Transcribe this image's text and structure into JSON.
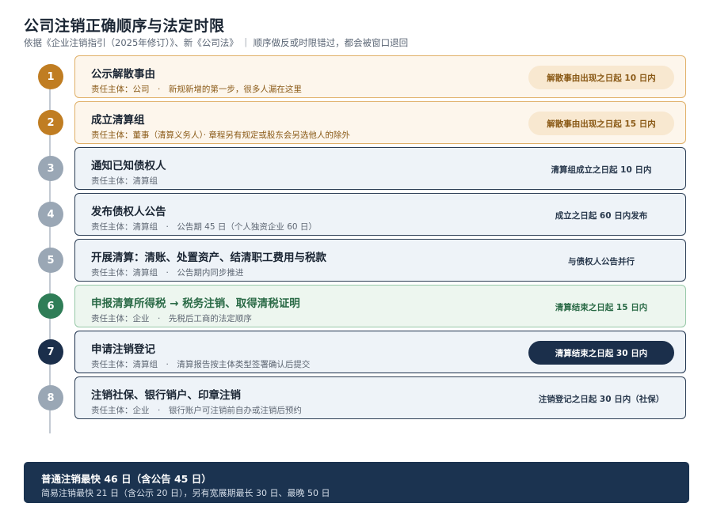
{
  "header": {
    "title": "公司注销正确顺序与法定时限",
    "subtitle": "依据《企业注销指引（2025年修订）》、新《公司法》 ｜ 顺序做反或时限错过，都会被窗口退回"
  },
  "steps": [
    {
      "number": "1",
      "title": "公示解散事由",
      "desc": "责任主体：公司　·　新规新增的第一步，很多人漏在这里",
      "deadline": "解散事由出现之日起 10 日内",
      "style": "warn"
    },
    {
      "number": "2",
      "title": "成立清算组",
      "desc": "责任主体：董事（清算义务人）· 章程另有规定或股东会另选他人的除外",
      "deadline": "解散事由出现之日起 15 日内",
      "style": "warn"
    },
    {
      "number": "3",
      "title": "通知已知债权人",
      "desc": "责任主体：清算组",
      "deadline": "清算组成立之日起 10 日内",
      "style": "norm"
    },
    {
      "number": "4",
      "title": "发布债权人公告",
      "desc": "责任主体：清算组　·　公告期 45 日（个人独资企业 60 日）",
      "deadline": "成立之日起 60 日内发布",
      "style": "norm"
    },
    {
      "number": "5",
      "title": "开展清算：清账、处置资产、结清职工费用与税款",
      "desc": "责任主体：清算组　·　公告期内同步推进",
      "deadline": "与债权人公告并行",
      "style": "norm"
    },
    {
      "number": "6",
      "title": "申报清算所得税 → 税务注销、取得清税证明",
      "desc": "责任主体：企业　·　先税后工商的法定顺序",
      "deadline": "清算结束之日起 15 日内",
      "style": "green"
    },
    {
      "number": "7",
      "title": "申请注销登记",
      "desc": "责任主体：清算组　·　清算报告按主体类型签署确认后提交",
      "deadline": "清算结束之日起 30 日内",
      "style": "dark"
    },
    {
      "number": "8",
      "title": "注销社保、银行销户、印章注销",
      "desc": "责任主体：企业　·　银行账户可注销前自办或注销后预约",
      "deadline": "注销登记之日起 30 日内（社保）",
      "style": "norm"
    }
  ],
  "footer": {
    "main": "普通注销最快 46 日（含公告 45 日）",
    "sub": "简易注销最快 21 日（含公示 20 日），另有宽展期最长 30 日、最晚 50 日"
  }
}
